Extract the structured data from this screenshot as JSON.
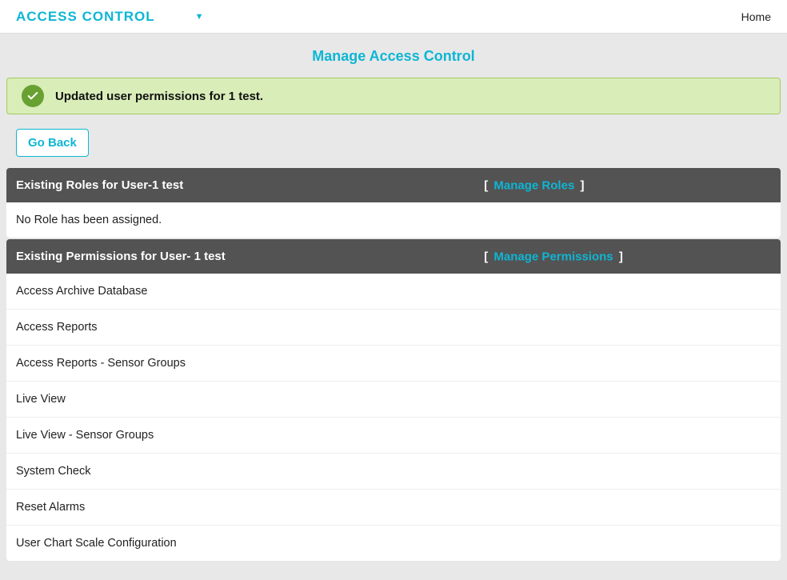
{
  "header": {
    "title": "ACCESS CONTROL",
    "home": "Home"
  },
  "page_title": "Manage Access Control",
  "alert_message": "Updated user permissions for 1 test.",
  "goback_label": "Go Back",
  "roles_panel": {
    "title": "Existing Roles for User-1 test",
    "link_label": "Manage Roles",
    "empty": "No Role has been assigned."
  },
  "permissions_panel": {
    "title": "Existing Permissions for User- 1 test",
    "link_label": "Manage Permissions"
  },
  "permissions": [
    "Access Archive Database",
    "Access Reports",
    "Access Reports - Sensor Groups",
    "Live View",
    "Live View - Sensor Groups",
    "System Check",
    "Reset Alarms",
    "User Chart Scale Configuration"
  ]
}
